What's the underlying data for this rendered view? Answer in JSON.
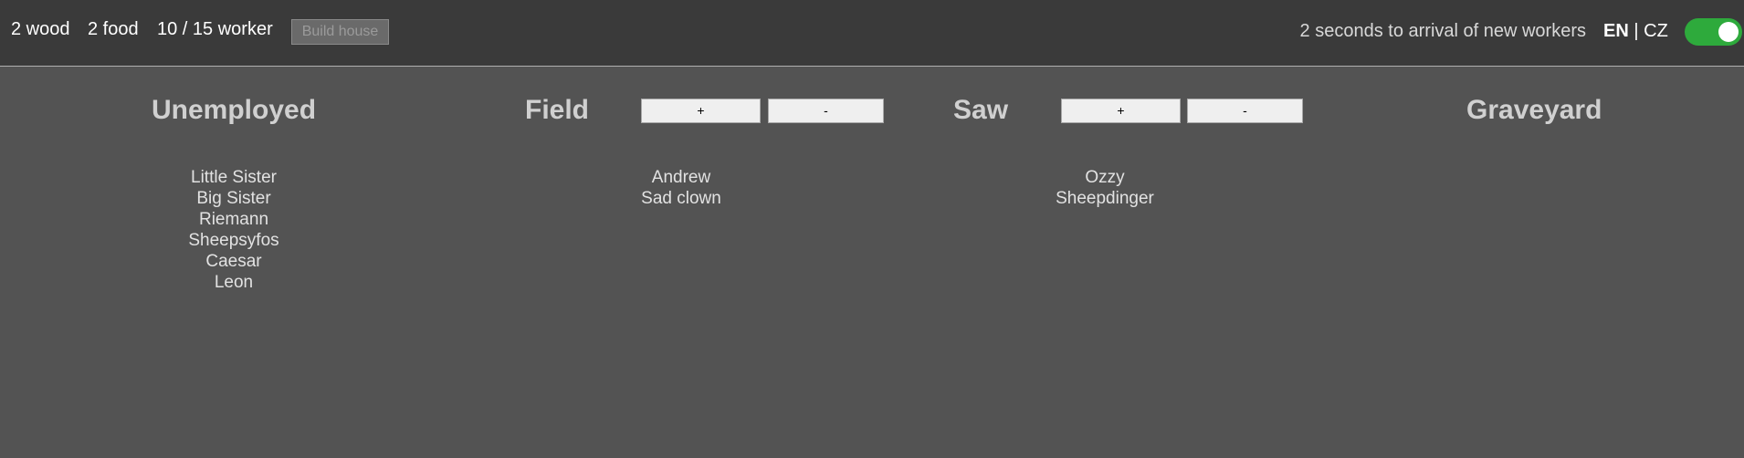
{
  "resources": {
    "wood": "2 wood",
    "food": "2 food",
    "worker": "10 / 15 worker"
  },
  "build_house_label": "Build house",
  "timer_text": "2 seconds to arrival of new workers",
  "language": {
    "en": "EN",
    "separator": "|",
    "cz": "CZ",
    "selected": "EN"
  },
  "toggle": {
    "on": true,
    "color": "#2eaa3c"
  },
  "columns": {
    "unemployed": {
      "title": "Unemployed",
      "workers": [
        "Little Sister",
        "Big Sister",
        "Riemann",
        "Sheepsyfos",
        "Caesar",
        "Leon"
      ]
    },
    "field": {
      "title": "Field",
      "plus_label": "+",
      "minus_label": "-",
      "workers": [
        "Andrew",
        "Sad clown"
      ]
    },
    "saw": {
      "title": "Saw",
      "plus_label": "+",
      "minus_label": "-",
      "workers": [
        "Ozzy",
        "Sheepdinger"
      ]
    },
    "graveyard": {
      "title": "Graveyard",
      "workers": []
    }
  }
}
